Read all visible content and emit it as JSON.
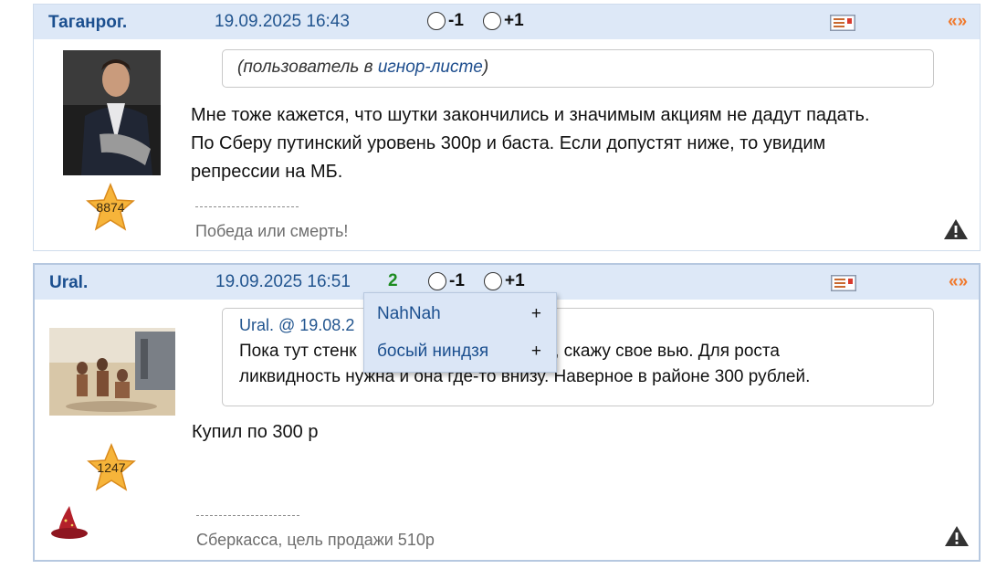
{
  "posts": [
    {
      "author": "Таганрог.",
      "datetime": "19.09.2025 16:43",
      "vote_minus": "-1",
      "vote_plus": "+1",
      "quote_icon_text": "«»",
      "rating": "8874",
      "ignored_prefix": "(пользователь в ",
      "ignored_link": "игнор-листе",
      "ignored_suffix": ")",
      "message_lines": [
        "Мне тоже кажется, что шутки закончились и значимым акциям не дадут падать.",
        "По Сберу путинский уровень 300р и баста. Если допустят ниже, то увидим",
        "репрессии на МБ."
      ],
      "signature": "Победа или смерть!"
    },
    {
      "author": "Ural.",
      "datetime": "19.09.2025 16:51",
      "score": "2",
      "vote_minus": "-1",
      "vote_plus": "+1",
      "quote_icon_text": "«»",
      "rating": "1247",
      "quote_header": "Ural. @ 19.08.2",
      "quote_lines": [
        "Пока тут стенк",
        "ятся, скажу свое вью. Для роста",
        "ликвидность нужна и она где-то внизу. Наверное в районе 300 рублей."
      ],
      "message": "Купил по 300 р",
      "signature": "Сберкасса, цель продажи 510р"
    }
  ],
  "voters_popup": {
    "items": [
      {
        "name": "NahNah",
        "action": "+"
      },
      {
        "name": "босый ниндзя",
        "action": "+"
      }
    ]
  },
  "colors": {
    "header_bg": "#dde8f7",
    "link_blue": "#1b4f8f",
    "score_green": "#1e8c22",
    "quote_orange": "#f07a2e",
    "star_gold": "#f6b43a"
  }
}
